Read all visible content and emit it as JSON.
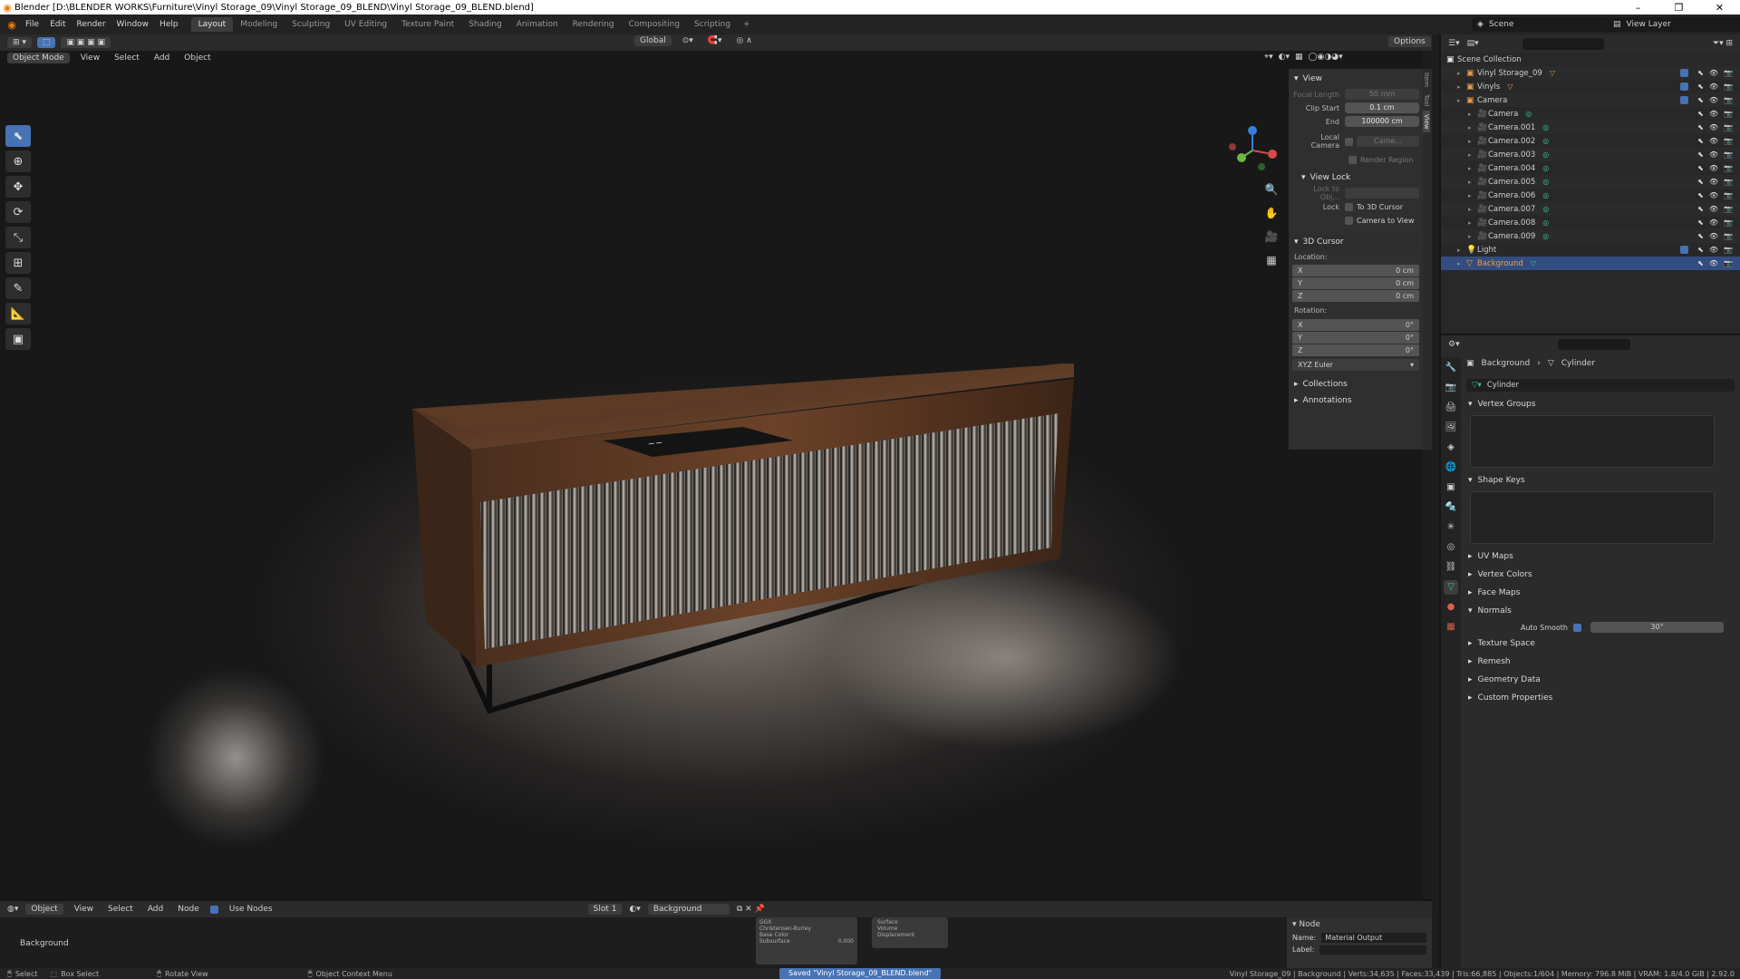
{
  "window": {
    "title": "Blender [D:\\BLENDER WORKS\\Furniture\\Vinyl Storage_09\\Vinyl Storage_09_BLEND\\Vinyl Storage_09_BLEND.blend]",
    "minimize": "–",
    "maximize": "❐",
    "close": "✕"
  },
  "menu": [
    "File",
    "Edit",
    "Render",
    "Window",
    "Help"
  ],
  "workspaces": [
    "Layout",
    "Modeling",
    "Sculpting",
    "UV Editing",
    "Texture Paint",
    "Shading",
    "Animation",
    "Rendering",
    "Compositing",
    "Scripting"
  ],
  "workspace_add": "+",
  "scene": {
    "label": "Scene",
    "view_layer": "View Layer"
  },
  "viewport_header": {
    "mode": "Object Mode",
    "menus": [
      "View",
      "Select",
      "Add",
      "Object"
    ],
    "transform": "Global",
    "options": "Options"
  },
  "npanel": {
    "tabs": [
      "Item",
      "Tool",
      "View"
    ],
    "view_title": "View",
    "focal_length_label": "Focal Length",
    "focal_length": "50 mm",
    "clip_start_label": "Clip Start",
    "clip_start": "0.1 cm",
    "clip_end_label": "End",
    "clip_end": "100000 cm",
    "local_camera_label": "Local Camera",
    "local_camera_value": "Came...",
    "render_region": "Render Region",
    "view_lock_title": "View Lock",
    "lock_to_obj": "Lock to Obj...",
    "lock_label": "Lock",
    "to_3d_cursor": "To 3D Cursor",
    "camera_to_view": "Camera to View",
    "cursor_title": "3D Cursor",
    "location_label": "Location:",
    "loc": [
      {
        "axis": "X",
        "val": "0 cm"
      },
      {
        "axis": "Y",
        "val": "0 cm"
      },
      {
        "axis": "Z",
        "val": "0 cm"
      }
    ],
    "rotation_label": "Rotation:",
    "rot": [
      {
        "axis": "X",
        "val": "0°"
      },
      {
        "axis": "Y",
        "val": "0°"
      },
      {
        "axis": "Z",
        "val": "0°"
      }
    ],
    "rotation_mode": "XYZ Euler",
    "collections": "Collections",
    "annotations": "Annotations"
  },
  "outliner": {
    "root": "Scene Collection",
    "rows": [
      {
        "name": "Vinyl Storage_09",
        "indent": 1,
        "icon": "▣",
        "data": "▽",
        "data_color": "orange",
        "check": true
      },
      {
        "name": "Vinyls",
        "indent": 1,
        "icon": "▣",
        "data": "▽",
        "data_color": "orange",
        "check": true
      },
      {
        "name": "Camera",
        "indent": 1,
        "icon": "▣",
        "data": "",
        "data_color": "",
        "check": true
      },
      {
        "name": "Camera",
        "indent": 2,
        "icon": "🎥",
        "data": "◎",
        "data_color": "green",
        "check": false
      },
      {
        "name": "Camera.001",
        "indent": 2,
        "icon": "🎥",
        "data": "◎",
        "data_color": "green",
        "check": false
      },
      {
        "name": "Camera.002",
        "indent": 2,
        "icon": "🎥",
        "data": "◎",
        "data_color": "green",
        "check": false
      },
      {
        "name": "Camera.003",
        "indent": 2,
        "icon": "🎥",
        "data": "◎",
        "data_color": "green",
        "check": false
      },
      {
        "name": "Camera.004",
        "indent": 2,
        "icon": "🎥",
        "data": "◎",
        "data_color": "green",
        "check": false
      },
      {
        "name": "Camera.005",
        "indent": 2,
        "icon": "🎥",
        "data": "◎",
        "data_color": "green",
        "check": false
      },
      {
        "name": "Camera.006",
        "indent": 2,
        "icon": "🎥",
        "data": "◎",
        "data_color": "green",
        "check": false
      },
      {
        "name": "Camera.007",
        "indent": 2,
        "icon": "🎥",
        "data": "◎",
        "data_color": "green",
        "check": false
      },
      {
        "name": "Camera.008",
        "indent": 2,
        "icon": "🎥",
        "data": "◎",
        "data_color": "green",
        "check": false
      },
      {
        "name": "Camera.009",
        "indent": 2,
        "icon": "🎥",
        "data": "◎",
        "data_color": "green",
        "check": false
      },
      {
        "name": "Light",
        "indent": 1,
        "icon": "💡",
        "data": "",
        "data_color": "",
        "check": true
      },
      {
        "name": "Background",
        "indent": 1,
        "icon": "▽",
        "data": "▽",
        "data_color": "green",
        "check": false,
        "selected": true
      }
    ]
  },
  "properties": {
    "object": "Background",
    "mesh_data": "Cylinder",
    "mesh_name": "Cylinder",
    "sections": [
      "Vertex Groups",
      "Shape Keys",
      "UV Maps",
      "Vertex Colors",
      "Face Maps",
      "Normals",
      "Texture Space",
      "Remesh",
      "Geometry Data",
      "Custom Properties"
    ],
    "auto_smooth_label": "Auto Smooth",
    "auto_smooth_angle": "30°"
  },
  "shader_editor": {
    "type": "Object",
    "menus": [
      "View",
      "Select",
      "Add",
      "Node"
    ],
    "use_nodes": "Use Nodes",
    "slot": "Slot 1",
    "material": "Background",
    "area_label": "Background",
    "node_title": "Node",
    "node_name_label": "Name:",
    "node_name": "Material Output",
    "node_label_label": "Label:",
    "bsdf_rows": [
      "GGX",
      "Christensen-Burley",
      "Base Color",
      "Subsurface"
    ],
    "subsurface_value": "0.000",
    "output_sockets": [
      "Surface",
      "Volume",
      "Displacement"
    ]
  },
  "status": {
    "select": "Select",
    "box_select": "Box Select",
    "rotate_view": "Rotate View",
    "context_menu": "Object Context Menu",
    "saved": "Saved \"Vinyl Storage_09_BLEND.blend\"",
    "stats": "Vinyl Storage_09 | Background | Verts:34,635 | Faces:33,439 | Tris:66,885 | Objects:1/604 | Memory: 796.8 MiB | VRAM: 1.8/4.0 GiB | 2.92.0"
  }
}
